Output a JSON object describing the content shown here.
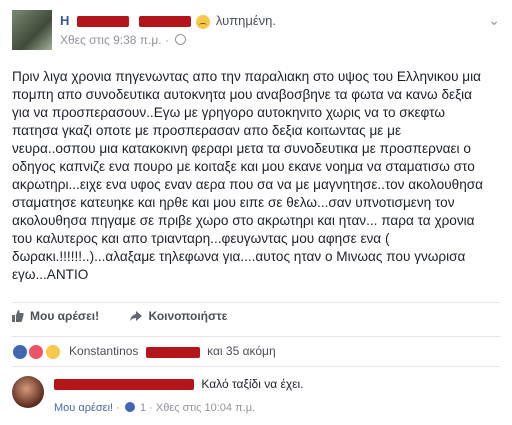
{
  "post": {
    "author_prefix": "Η",
    "feeling": "λυπημένη.",
    "time": "Χθες στις 9:38 π.μ.",
    "body_lines": [
      "Πριν λιγα χρονια πηγενωντας απο την παραλιακη στο υψος του Ελληνικου μια",
      "πομπη απο συνοδευτικα αυτοκνητα μου αναβοσβηνε τα φωτα να κανω δεξια",
      "για να προσπερασουν..Εγω με γρηγορο αυτοκηνιτο χωρις να το σκεφτω",
      "πατησα γκαζι οποτε με προσπερασαν απο δεξια κοιτωντας με με",
      "νευρα..οσπου μια κατακοκινη φεραρι μετα τα συνοδευτικα με προσπερναει ο",
      "οδηγος καπνιζε ενα πουρο με κοιταξε και μου εκανε νοημα να σταματισω στο",
      "ακρωτηρι...ειχε ενα υφος εναν αερα που σα να με μαγνητησε..τον ακολουθησα",
      "σταματησε κατευηκε και ηρθε και μου ειπε σε θελω...σαν υπνοτισμενη τον",
      "ακολουθησα πηγαμε σε πριβε χωρο στο ακρωτηρι και ηταν... παρα τα χρονια",
      "του καλυτερος και απο τριανταρη...φευγωντας μου αφησε ενα (",
      "δωρακι.!!!!!!..)...αλαξαμε τηλεφωνα για....αυτος ηταν ο Μινωας που γνωρισα",
      "εγω...ΑΝΤΙΟ"
    ]
  },
  "actions": {
    "like": "Μου αρέσει!",
    "share": "Κοινοποιήστε"
  },
  "reactions": {
    "name": "Konstantinos",
    "more": "και 35 ακόμη"
  },
  "comment": {
    "text": "Καλό ταξίδι να έχει.",
    "like": "Μου αρέσει!",
    "likes_count": "1",
    "time": "Χθες στις 10:04 π.μ."
  },
  "colors": {
    "link": "#365899",
    "redaction": "#b3151b",
    "like_blue": "#4267b2"
  },
  "icons": [
    "globe-icon",
    "chevron-down-icon",
    "thumbs-up-icon",
    "share-arrow-icon",
    "like-reaction-icon",
    "love-reaction-icon",
    "sad-reaction-icon"
  ]
}
